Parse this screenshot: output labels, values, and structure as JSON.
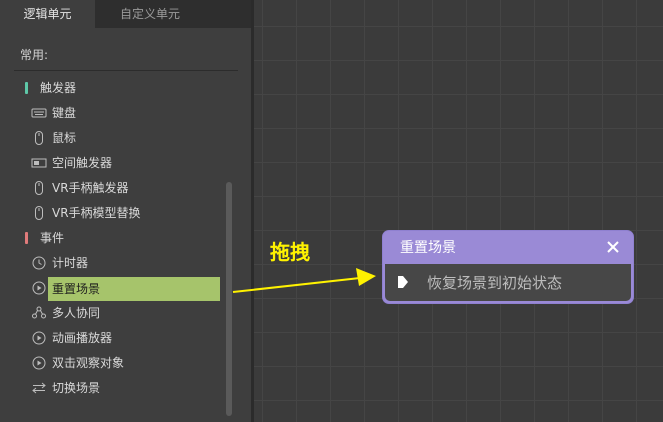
{
  "tabs": {
    "logic_units": "逻辑单元",
    "custom_units": "自定义单元"
  },
  "section_header": "常用:",
  "categories": {
    "trigger": {
      "label": "触发器",
      "color": "#5ec8a8"
    },
    "event": {
      "label": "事件",
      "color": "#e07b7b"
    }
  },
  "items": {
    "keyboard": "键盘",
    "mouse": "鼠标",
    "space_trigger": "空间触发器",
    "vr_controller_trigger": "VR手柄触发器",
    "vr_controller_model_swap": "VR手柄模型替换",
    "timer": "计时器",
    "reset_scene": "重置场景",
    "multiplayer": "多人协同",
    "animation_player": "动画播放器",
    "double_click_observe": "双击观察对象",
    "switch_scene": "切换场景"
  },
  "drag_label": "拖拽",
  "node": {
    "title": "重置场景",
    "action": "恢复场景到初始状态",
    "header_color": "#9a8ad6"
  },
  "colors": {
    "selection": "#a6c46b",
    "arrow": "#fff200"
  }
}
